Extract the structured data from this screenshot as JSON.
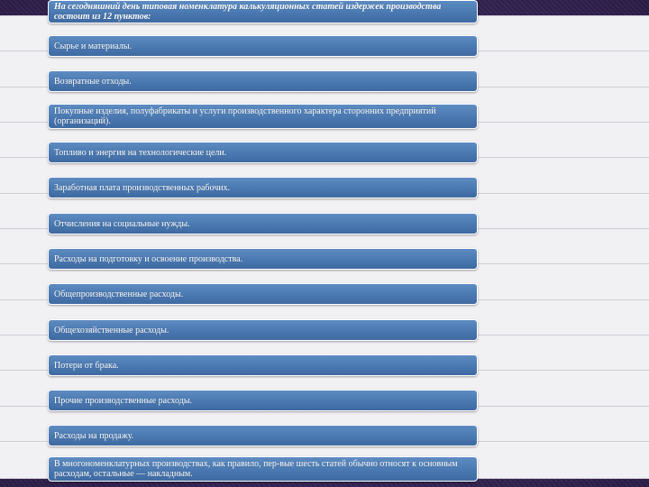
{
  "slide": {
    "title": "На сегодняшний день типовая номенклатура калькуляционных статей издержек производства состоит из 12 пунктов:",
    "items": [
      "Сырье и материалы.",
      "Возвратные отходы.",
      "Покупные изделия, полуфабрикаты и услуги производственного характера сторонних предприятий (организаций).",
      "Топливо и энергия на технологические цели.",
      "Заработная плата производственных рабочих.",
      "Отчисления на социальные нужды.",
      "Расходы на подготовку и освоение производства.",
      "Общепроизводственные расходы.",
      "Общехозяйственные расходы.",
      "Потери от брака.",
      "Прочие производственные расходы.",
      "Расходы на продажу.",
      "В многономенклатурных производствах, как правило, пер-вые шесть статей обычно относят к основным расходам, остальные — накладным."
    ]
  }
}
